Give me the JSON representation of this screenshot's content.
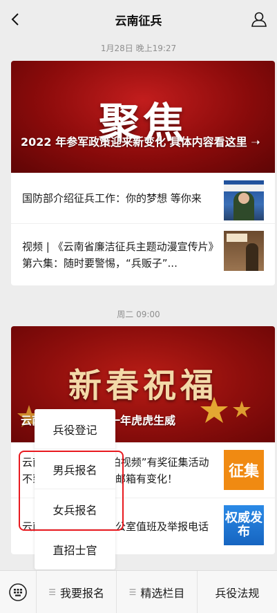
{
  "header": {
    "title": "云南征兵"
  },
  "messages": [
    {
      "time": "1月28日 晚上19:27",
      "cover_big_text": "聚焦",
      "cover_title": "2022 年参军政策迎来新变化 具体内容看这里 ➝",
      "items": [
        {
          "text": "国防部介绍征兵工作：你的梦想 等你来"
        },
        {
          "text": "视频 | 《云南省廉洁征兵主题动漫宣传片》第六集：随时要警惕，“兵贩子”..."
        }
      ]
    },
    {
      "time": "周二 09:00",
      "cover_big_text": "新春祝福",
      "cover_title": "云南征兵祝您新的一年虎虎生威",
      "items": [
        {
          "text": "云南征兵“我为征兵拍视频”有奖征集活动不到一月截止，投稿邮箱有变化！",
          "thumb_text": "征集"
        },
        {
          "text": "云南省各州市征兵办公室值班及举报电话",
          "thumb_text": "权威发布"
        }
      ]
    }
  ],
  "popup_menu": {
    "items": [
      "兵役登记",
      "男兵报名",
      "女兵报名",
      "直招士官"
    ],
    "highlighted": [
      "男兵报名",
      "女兵报名"
    ],
    "highlight_color": "#e8181e"
  },
  "bottom_menu": {
    "tabs": [
      "我要报名",
      "精选栏目",
      "兵役法规"
    ]
  },
  "icons": [
    "back-icon",
    "user-icon",
    "keyboard-icon"
  ]
}
